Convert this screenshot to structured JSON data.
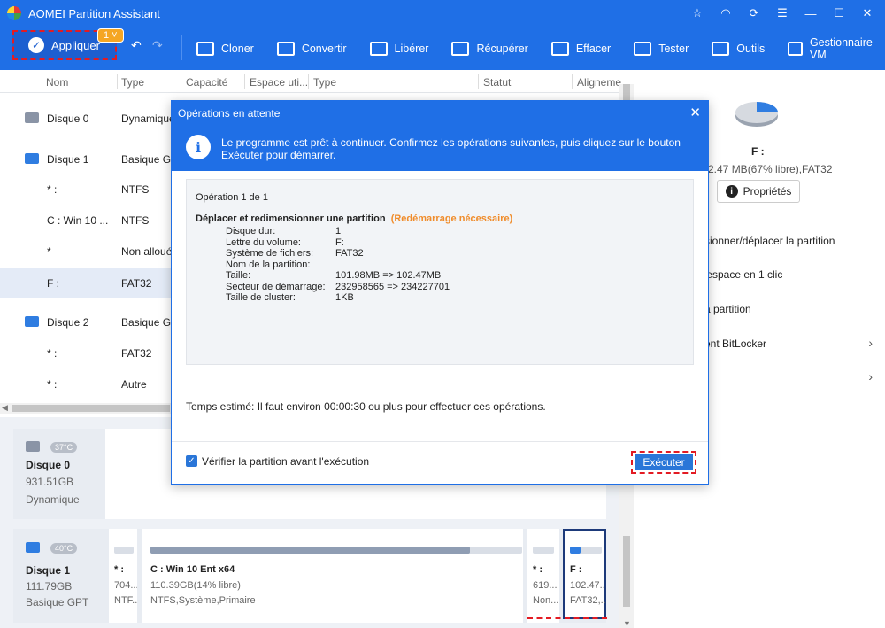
{
  "app": {
    "title": "AOMEI Partition Assistant"
  },
  "toolbar": {
    "apply_label": "Appliquer",
    "pending_count": "1",
    "tools": [
      {
        "label": "Cloner",
        "icon": "clone-icon"
      },
      {
        "label": "Convertir",
        "icon": "convert-icon"
      },
      {
        "label": "Libérer",
        "icon": "free-icon"
      },
      {
        "label": "Récupérer",
        "icon": "recover-icon"
      },
      {
        "label": "Effacer",
        "icon": "wipe-icon"
      },
      {
        "label": "Tester",
        "icon": "test-icon"
      },
      {
        "label": "Outils",
        "icon": "tools-icon"
      },
      {
        "label": "Gestionnaire VM",
        "icon": "vm-icon"
      }
    ]
  },
  "grid": {
    "headers": [
      "Nom",
      "Type",
      "Capacité",
      "Espace uti...",
      "Type",
      "Statut",
      "Aligneme"
    ],
    "rows": [
      {
        "name": "Disque 0",
        "type": "Dynamique",
        "kind": "disk"
      },
      {
        "name": "Disque 1",
        "type": "Basique G...",
        "kind": "disk-ssd"
      },
      {
        "name": "* :",
        "type": "NTFS",
        "kind": "part"
      },
      {
        "name": "C : Win 10 ...",
        "type": "NTFS",
        "kind": "part"
      },
      {
        "name": "*",
        "type": "Non alloué",
        "kind": "part"
      },
      {
        "name": "F :",
        "type": "FAT32",
        "kind": "part"
      },
      {
        "name": "Disque 2",
        "type": "Basique G...",
        "kind": "disk-ssd"
      },
      {
        "name": "* :",
        "type": "FAT32",
        "kind": "part"
      },
      {
        "name": "* :",
        "type": "Autre",
        "kind": "part"
      }
    ]
  },
  "diskmap": {
    "disk0": {
      "temp": "37°C",
      "name": "Disque 0",
      "size": "931.51GB",
      "type": "Dynamique"
    },
    "disk1": {
      "temp": "40°C",
      "name": "Disque 1",
      "size": "111.79GB",
      "type": "Basique GPT",
      "parts": [
        {
          "label": "* :",
          "size": "704...",
          "fs": "NTF...",
          "used": 0
        },
        {
          "label": "C : Win 10 Ent x64",
          "size": "110.39GB(14% libre)",
          "fs": "NTFS,Système,Primaire",
          "used": 86
        },
        {
          "label": "* :",
          "size": "619...",
          "fs": "Non...",
          "used": 0
        },
        {
          "label": "F :",
          "size": "102.47...",
          "fs": "FAT32,...",
          "used": 33
        }
      ]
    }
  },
  "right": {
    "drive": "F :",
    "detail": "2.47 MB(67% libre),FAT32",
    "properties_label": "Propriétés",
    "actions": [
      "sionner/déplacer la partition",
      "'espace en 1 clic",
      "a partition",
      "ent BitLocker",
      ""
    ]
  },
  "modal": {
    "title": "Opérations en attente",
    "info": "Le programme est prêt à continuer. Confirmez les opérations suivantes, puis cliquez sur le bouton Exécuter pour démarrer.",
    "op_count": "Opération 1 de 1",
    "op_title": "Déplacer et redimensionner une partition",
    "op_note": "(Redémarrage nécessaire)",
    "fields": [
      {
        "k": "Disque dur:",
        "v": "1"
      },
      {
        "k": "Lettre du volume:",
        "v": "F:"
      },
      {
        "k": "Système de fichiers:",
        "v": "FAT32"
      },
      {
        "k": "Nom de la partition:",
        "v": ""
      },
      {
        "k": "Taille:",
        "v": "101.98MB => 102.47MB"
      },
      {
        "k": "Secteur de démarrage:",
        "v": "232958565 => 234227701"
      },
      {
        "k": "Taille de cluster:",
        "v": "1KB"
      }
    ],
    "estimate": "Temps estimé: Il faut environ 00:00:30 ou plus pour effectuer ces opérations.",
    "verify_label": "Vérifier la partition avant l'exécution",
    "execute_label": "Exécuter"
  }
}
